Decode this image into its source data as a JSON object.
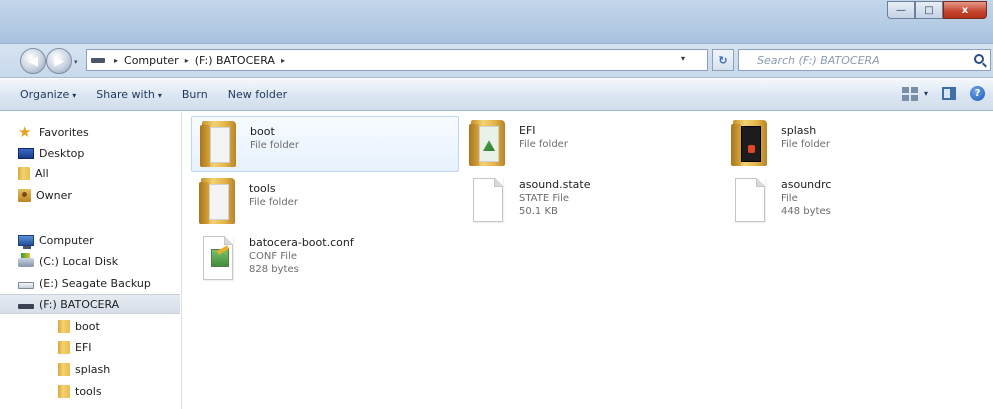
{
  "window": {
    "minimize": "—",
    "maximize": "□",
    "close": "x"
  },
  "address": {
    "crumbs": [
      "Computer",
      "(F:) BATOCERA"
    ],
    "separator": "▸",
    "search_placeholder": "Search (F:) BATOCERA",
    "refresh_glyph": "↻"
  },
  "nav_buttons": {
    "back_glyph": "◀",
    "forward_glyph": "▶"
  },
  "toolbar": {
    "organize": "Organize",
    "share_with": "Share with",
    "burn": "Burn",
    "new_folder": "New folder",
    "caret": "▾",
    "help": "?"
  },
  "navpane": {
    "favorites": "Favorites",
    "desktop": "Desktop",
    "all": "All",
    "owner": "Owner",
    "computer": "Computer",
    "local_disk": "(C:) Local Disk",
    "seagate": "(E:) Seagate Backup",
    "batocera": "(F:) BATOCERA",
    "boot": "boot",
    "efi": "EFI",
    "splash": "splash",
    "tools": "tools"
  },
  "files": [
    {
      "name": "boot",
      "type": "File folder",
      "size": ""
    },
    {
      "name": "EFI",
      "type": "File folder",
      "size": ""
    },
    {
      "name": "splash",
      "type": "File folder",
      "size": ""
    },
    {
      "name": "tools",
      "type": "File folder",
      "size": ""
    },
    {
      "name": "asound.state",
      "type": "STATE File",
      "size": "50.1 KB"
    },
    {
      "name": "asoundrc",
      "type": "File",
      "size": "448 bytes"
    },
    {
      "name": "batocera-boot.conf",
      "type": "CONF File",
      "size": "828 bytes"
    }
  ]
}
